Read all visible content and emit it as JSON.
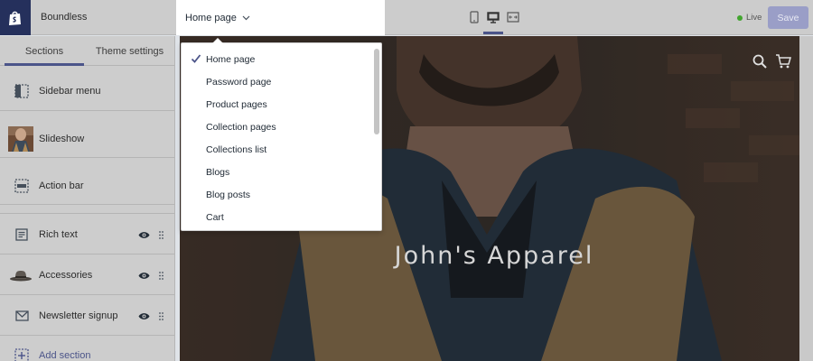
{
  "app": {
    "theme_name": "Boundless",
    "logo_icon": "shopify-bag-icon",
    "brand_color": "#25305c",
    "accent_color": "#4b5489"
  },
  "topbar": {
    "page_selector_label": "Home page",
    "devices": [
      "mobile-icon",
      "desktop-icon",
      "fullscreen-icon"
    ],
    "active_device": "desktop-icon",
    "status_label": "Live",
    "status_color": "#42a52f",
    "save_label": "Save"
  },
  "sidebar": {
    "tabs": [
      {
        "label": "Sections",
        "active": true
      },
      {
        "label": "Theme settings",
        "active": false
      }
    ],
    "sections": [
      {
        "label": "Sidebar menu",
        "icon": "sidebar-layout-icon"
      },
      {
        "label": "Slideshow",
        "icon": "slideshow-thumbnail"
      },
      {
        "label": "Action bar",
        "icon": "action-bar-icon"
      },
      {
        "label": "Rich text",
        "icon": "text-icon",
        "visible": true
      },
      {
        "label": "Accessories",
        "icon": "hat-thumbnail",
        "visible": true
      },
      {
        "label": "Newsletter signup",
        "icon": "mail-icon",
        "visible": true
      }
    ],
    "add_section_label": "Add section"
  },
  "dropdown": {
    "selected": "Home page",
    "options": [
      "Home page",
      "Password page",
      "Product pages",
      "Collection pages",
      "Collections list",
      "Blogs",
      "Blog posts",
      "Cart"
    ]
  },
  "preview": {
    "store_title": "John's Apparel",
    "header_icons": [
      "search-icon",
      "cart-icon"
    ]
  }
}
